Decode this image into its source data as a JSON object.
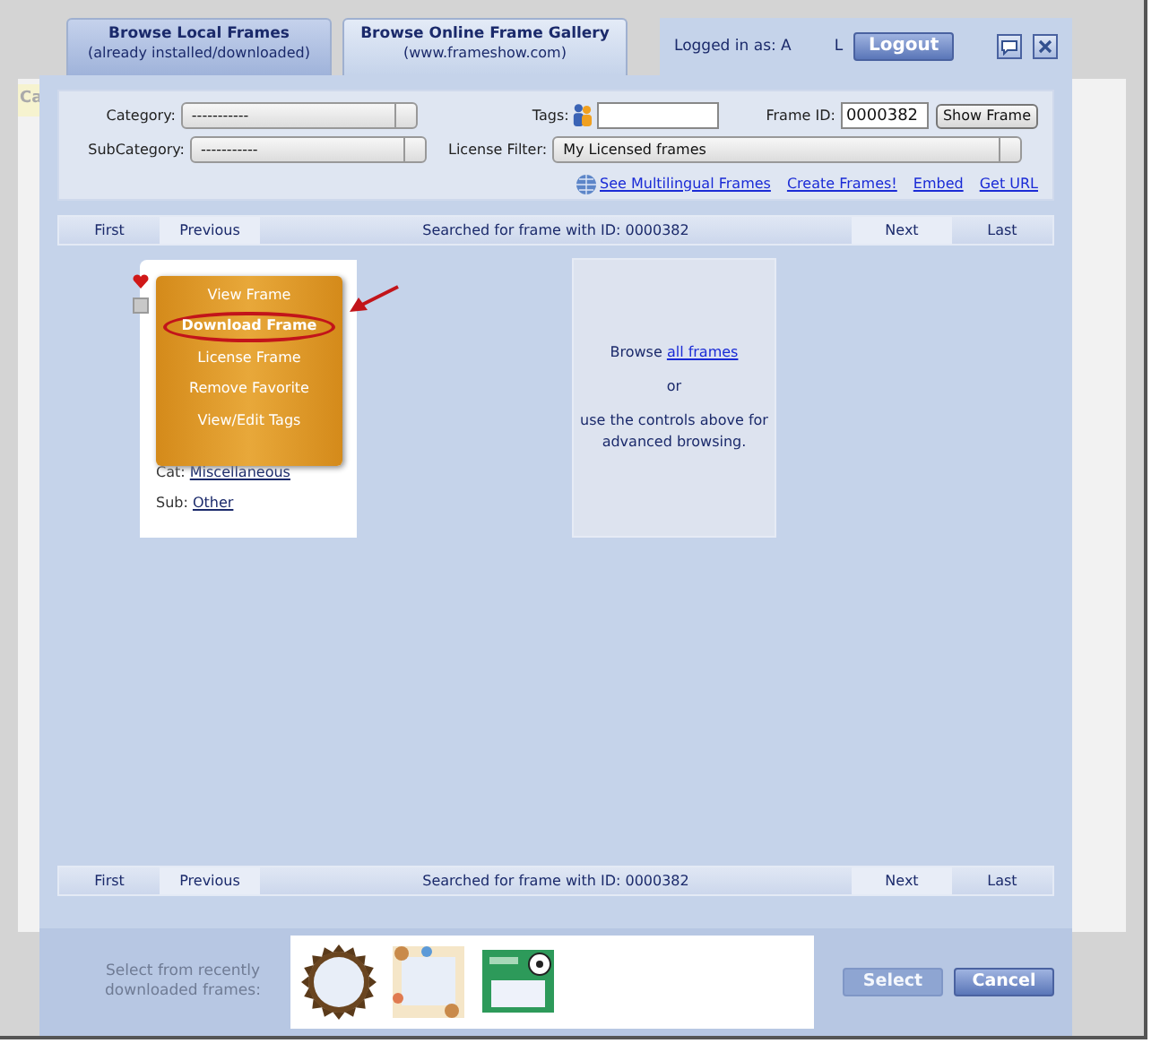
{
  "background": {
    "text": "Ca"
  },
  "tabs": [
    {
      "label": "Browse Local Frames",
      "sublabel": "(already installed/downloaded)",
      "selected": false
    },
    {
      "label": "Browse Online Frame Gallery",
      "sublabel": "(www.frameshow.com)",
      "selected": true
    }
  ],
  "account": {
    "label": "Logged in as: A",
    "initial": "L",
    "logout": "Logout"
  },
  "filters": {
    "category_label": "Category:",
    "category_value": "-----------",
    "subcategory_label": "SubCategory:",
    "subcategory_value": "-----------",
    "tags_label": "Tags:",
    "frame_id_label": "Frame ID:",
    "frame_id_value": "0000382",
    "show_frame": "Show Frame",
    "license_label": "License Filter:",
    "license_value": "My Licensed frames",
    "links": [
      "See Multilingual Frames",
      "Create Frames!",
      "Embed",
      "Get URL"
    ]
  },
  "pagers": [
    {
      "first": "First",
      "previous": "Previous",
      "status": "Searched for frame with ID: 0000382",
      "next": "Next",
      "last": "Last"
    },
    {
      "first": "First",
      "previous": "Previous",
      "status": "Searched for frame with ID: 0000382",
      "next": "Next",
      "last": "Last"
    }
  ],
  "frame_card": {
    "favorite": true,
    "menu": [
      {
        "label": "View Frame",
        "highlighted": false
      },
      {
        "label": "Download Frame",
        "highlighted": true
      },
      {
        "label": "License Frame",
        "highlighted": false
      },
      {
        "label": "Remove Favorite",
        "highlighted": false
      },
      {
        "label": "View/Edit Tags",
        "highlighted": false
      }
    ],
    "cat_label": "Cat:",
    "cat_value": "Miscellaneous",
    "sub_label": "Sub:",
    "sub_value": "Other"
  },
  "browse_panel": {
    "prefix": "Browse",
    "link": "all frames",
    "or": "or",
    "hint": "use the controls above for advanced browsing."
  },
  "recent": {
    "label": "Select from recently downloaded frames:",
    "thumbnails": [
      {
        "kind": "sunburst"
      },
      {
        "kind": "floral"
      },
      {
        "kind": "soccer"
      }
    ]
  },
  "buttons": [
    {
      "label": "Select",
      "disabled": true
    },
    {
      "label": "Cancel",
      "disabled": false
    }
  ]
}
